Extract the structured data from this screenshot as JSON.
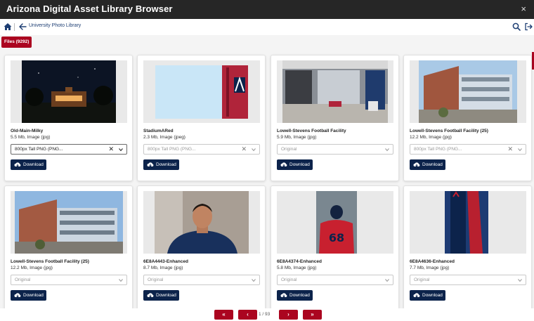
{
  "window": {
    "title": "Arizona Digital Asset Library Browser",
    "close_glyph": "×"
  },
  "nav": {
    "breadcrumb": "University Photo Library"
  },
  "files_badge": "Files (9292)",
  "download_label": "Download",
  "cards": [
    {
      "name": "Old-Main-Milky",
      "meta": "5.5 Mb, Image (jpg)",
      "select_value": "800px Tall PNG (PNG...",
      "select_active": true,
      "clearable": true
    },
    {
      "name": "StadiumARed",
      "meta": "2.3 Mb, Image (jpeg)",
      "select_value": "800px Tall PNG (PNG...",
      "select_active": false,
      "clearable": true
    },
    {
      "name": "Lowell-Stevens Football Facility",
      "meta": "5.9 Mb, Image (jpg)",
      "select_value": "Original",
      "select_active": false,
      "clearable": false
    },
    {
      "name": "Lowell-Stevens Football Facility (25)",
      "meta": "12.2 Mb, Image (jpg)",
      "select_value": "800px Tall PNG (PNG...",
      "select_active": false,
      "clearable": true
    },
    {
      "name": "Lowell-Stevens Football Facility (25)",
      "meta": "12.2 Mb, Image (jpg)",
      "select_value": "Original",
      "select_active": false,
      "clearable": false
    },
    {
      "name": "6E8A4443-Enhanced",
      "meta": "8.7 Mb, Image (jpg)",
      "select_value": "Original",
      "select_active": false,
      "clearable": false
    },
    {
      "name": "6E8A4374-Enhanced",
      "meta": "5.8 Mb, Image (jpg)",
      "select_value": "Original",
      "select_active": false,
      "clearable": false
    },
    {
      "name": "6E8A4636-Enhanced",
      "meta": "7.7 Mb, Image (jpg)",
      "select_value": "Original",
      "select_active": false,
      "clearable": false
    }
  ],
  "pagination": {
    "first": "«",
    "prev": "‹",
    "next": "›",
    "last": "»",
    "info": "1 / 93"
  },
  "colors": {
    "accent": "#ab0520",
    "navy": "#0c234b",
    "titlebar": "#262626"
  }
}
